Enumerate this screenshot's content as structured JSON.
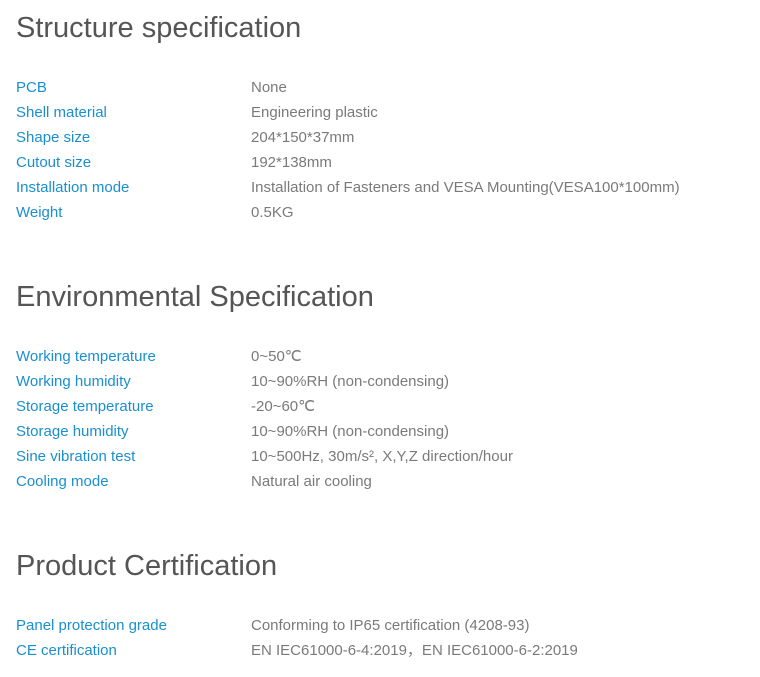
{
  "sections": [
    {
      "title": "Structure specification",
      "rows": [
        {
          "label": "PCB",
          "value": "None"
        },
        {
          "label": "Shell material",
          "value": "Engineering plastic"
        },
        {
          "label": "Shape size",
          "value": "204*150*37mm"
        },
        {
          "label": "Cutout size",
          "value": "192*138mm"
        },
        {
          "label": "Installation mode",
          "value": "Installation of Fasteners and VESA Mounting(VESA100*100mm)"
        },
        {
          "label": "Weight",
          "value": "0.5KG"
        }
      ]
    },
    {
      "title": "Environmental Specification",
      "rows": [
        {
          "label": "Working temperature",
          "value": "0~50℃"
        },
        {
          "label": "Working humidity",
          "value": "10~90%RH (non-condensing)"
        },
        {
          "label": "Storage temperature",
          "value": "-20~60℃"
        },
        {
          "label": "Storage humidity",
          "value": "10~90%RH (non-condensing)"
        },
        {
          "label": "Sine vibration test",
          "value": "10~500Hz, 30m/s², X,Y,Z direction/hour"
        },
        {
          "label": "Cooling mode",
          "value": "Natural air cooling"
        }
      ]
    },
    {
      "title": "Product Certification",
      "rows": [
        {
          "label": "Panel protection grade",
          "value": "Conforming to IP65 certification (4208-93)"
        },
        {
          "label": "CE certification",
          "value": "EN IEC61000-6-4:2019，EN IEC61000-6-2:2019"
        }
      ]
    }
  ],
  "colors": {
    "label": "#1a8fd0",
    "value": "#7a7a7a",
    "title": "#555555"
  }
}
